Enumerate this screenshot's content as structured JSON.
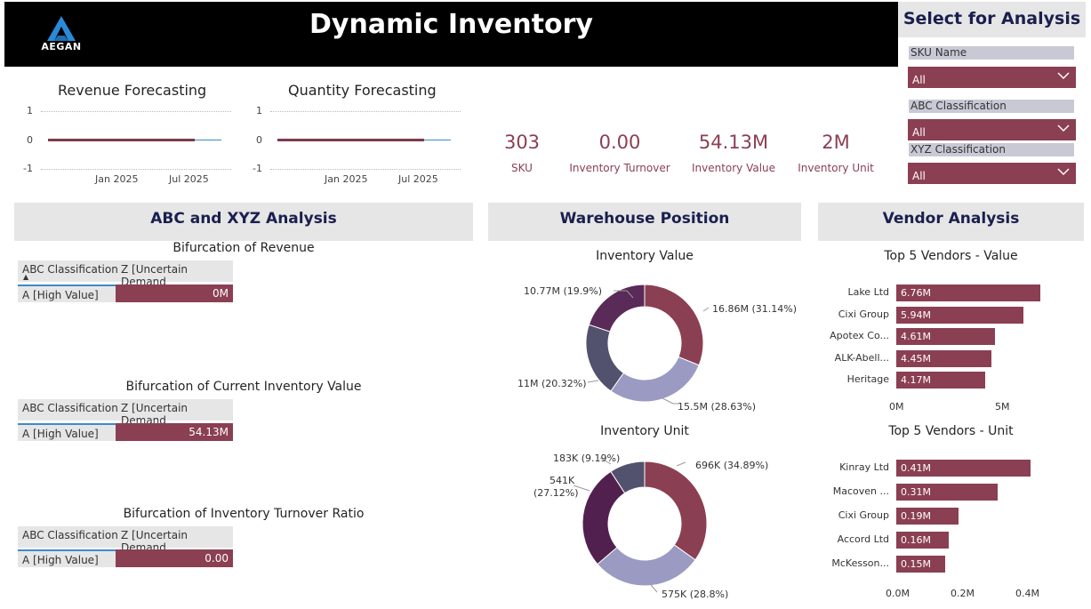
{
  "header": {
    "title": "Dynamic Inventory",
    "logo_text": "AEGAN"
  },
  "filters": {
    "title": "Select for Analysis",
    "sku": {
      "label": "SKU Name",
      "value": "All"
    },
    "abc": {
      "label": "ABC Classification",
      "value": "All"
    },
    "xyz": {
      "label": "XYZ Classification",
      "value": "All"
    }
  },
  "forecasting": {
    "revenue": {
      "title": "Revenue Forecasting",
      "y_ticks": [
        "1",
        "0",
        "-1"
      ],
      "x_ticks": [
        "Jan 2025",
        "Jul 2025"
      ]
    },
    "quantity": {
      "title": "Quantity Forecasting",
      "y_ticks": [
        "1",
        "0",
        "-1"
      ],
      "x_ticks": [
        "Jan 2025",
        "Jul 2025"
      ]
    }
  },
  "kpis": [
    {
      "value": "303",
      "label": "SKU"
    },
    {
      "value": "0.00",
      "label": "Inventory Turnover"
    },
    {
      "value": "54.13M",
      "label": "Inventory Value"
    },
    {
      "value": "2M",
      "label": "Inventory Unit"
    }
  ],
  "abc_xyz": {
    "title": "ABC and XYZ Analysis",
    "tables": [
      {
        "title": "Bifurcation of Revenue",
        "col1": "ABC Classification",
        "col2": "Z [Uncertain Demand",
        "row_label": "A [High Value]",
        "row_value": "0M"
      },
      {
        "title": "Bifurcation of Current Inventory Value",
        "col1": "ABC Classification",
        "col2": "Z [Uncertain Demand",
        "row_label": "A [High Value]",
        "row_value": "54.13M"
      },
      {
        "title": "Bifurcation of Inventory Turnover Ratio",
        "col1": "ABC Classification",
        "col2": "Z [Uncertain Demand",
        "row_label": "A [High Value]",
        "row_value": "0.00"
      }
    ]
  },
  "warehouse": {
    "title": "Warehouse Position",
    "value_chart": {
      "title": "Inventory Value",
      "labels": [
        "16.86M (31.14%)",
        "15.5M (28.63%)",
        "11M (20.32%)",
        "10.77M (19.9%)"
      ]
    },
    "unit_chart": {
      "title": "Inventory Unit",
      "labels": [
        "696K (34.89%)",
        "575K (28.8%)",
        "541K",
        "(27.12%)",
        "183K (9.19%)"
      ]
    }
  },
  "vendor": {
    "title": "Vendor Analysis",
    "value_chart": {
      "title": "Top 5 Vendors - Value",
      "axis": [
        "0M",
        "5M"
      ]
    },
    "unit_chart": {
      "title": "Top 5 Vendors - Unit",
      "axis": [
        "0.0M",
        "0.2M",
        "0.4M"
      ]
    }
  },
  "chart_data": [
    {
      "type": "pie",
      "title": "Inventory Value",
      "values": [
        16.86,
        15.5,
        11,
        10.77
      ],
      "percent": [
        31.14,
        28.63,
        20.32,
        19.9
      ],
      "colors": [
        "#8b3f52",
        "#9a9ac2",
        "#52526e",
        "#5a2a58"
      ]
    },
    {
      "type": "pie",
      "title": "Inventory Unit",
      "values": [
        696,
        575,
        541,
        183
      ],
      "percent": [
        34.89,
        28.8,
        27.12,
        9.19
      ],
      "colors": [
        "#8b3f52",
        "#9a9ac2",
        "#52204e",
        "#52526e"
      ]
    },
    {
      "type": "bar",
      "title": "Top 5 Vendors - Value",
      "categories": [
        "Lake Ltd",
        "Cixi Group",
        "Apotex Co...",
        "ALK-Abell...",
        "Heritage"
      ],
      "values": [
        6.76,
        5.94,
        4.61,
        4.45,
        4.17
      ],
      "value_labels": [
        "6.76M",
        "5.94M",
        "4.61M",
        "4.45M",
        "4.17M"
      ],
      "xlim": [
        0,
        7
      ]
    },
    {
      "type": "bar",
      "title": "Top 5 Vendors - Unit",
      "categories": [
        "Kinray Ltd",
        "Macoven ...",
        "Cixi Group",
        "Accord Ltd",
        "McKesson..."
      ],
      "values": [
        0.41,
        0.31,
        0.19,
        0.16,
        0.15
      ],
      "value_labels": [
        "0.41M",
        "0.31M",
        "0.19M",
        "0.16M",
        "0.15M"
      ],
      "xlim": [
        0,
        0.42
      ]
    }
  ]
}
